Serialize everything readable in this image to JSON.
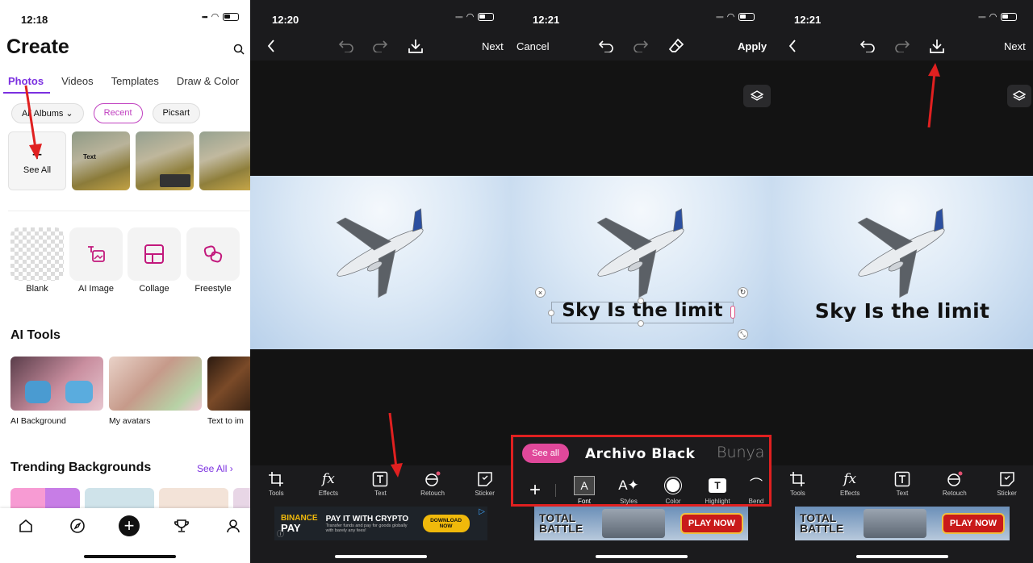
{
  "panel1": {
    "time": "12:18",
    "title": "Create",
    "tabs": [
      "Photos",
      "Videos",
      "Templates",
      "Draw & Color"
    ],
    "chips": [
      "All Albums",
      "Recent",
      "Picsart"
    ],
    "see_all_tile": "See All",
    "start_cards": [
      "Blank",
      "AI Image",
      "Collage",
      "Freestyle"
    ],
    "ai_tools_title": "AI Tools",
    "ai_tools": [
      "AI Background",
      "My avatars",
      "Text to im"
    ],
    "trending_title": "Trending Backgrounds",
    "trending_see_all": "See All",
    "thumb_text": "Text"
  },
  "panel2": {
    "time": "12:20",
    "next_label": "Next",
    "tools": [
      "Tools",
      "Effects",
      "Text",
      "Retouch",
      "Sticker"
    ],
    "ad": {
      "brand": "BINANCE",
      "brand2": "PAY",
      "headline": "PAY IT WITH CRYPTO",
      "sub": "Transfer funds and pay for goods globally with barely any fees!",
      "cta": "DOWNLOAD NOW"
    }
  },
  "panel3": {
    "time": "12:21",
    "cancel_label": "Cancel",
    "apply_label": "Apply",
    "overlay_text": "Sky Is the limit",
    "see_all": "See all",
    "font_current": "Archivo Black",
    "font_next": "Bunya",
    "text_tools": [
      "Font",
      "Styles",
      "Color",
      "Highlight",
      "Bend"
    ],
    "ad": {
      "title": "TOTAL BATTLE",
      "cta": "PLAY NOW"
    }
  },
  "panel4": {
    "time": "12:21",
    "next_label": "Next",
    "overlay_text": "Sky Is the limit",
    "tools": [
      "Tools",
      "Effects",
      "Text",
      "Retouch",
      "Sticker"
    ],
    "ad": {
      "title": "TOTAL BATTLE",
      "cta": "PLAY NOW"
    }
  },
  "colors": {
    "accent": "#7b2fe0",
    "pink": "#e0489a",
    "red_highlight": "#e02020",
    "dark_bg": "#1b1b1d"
  }
}
